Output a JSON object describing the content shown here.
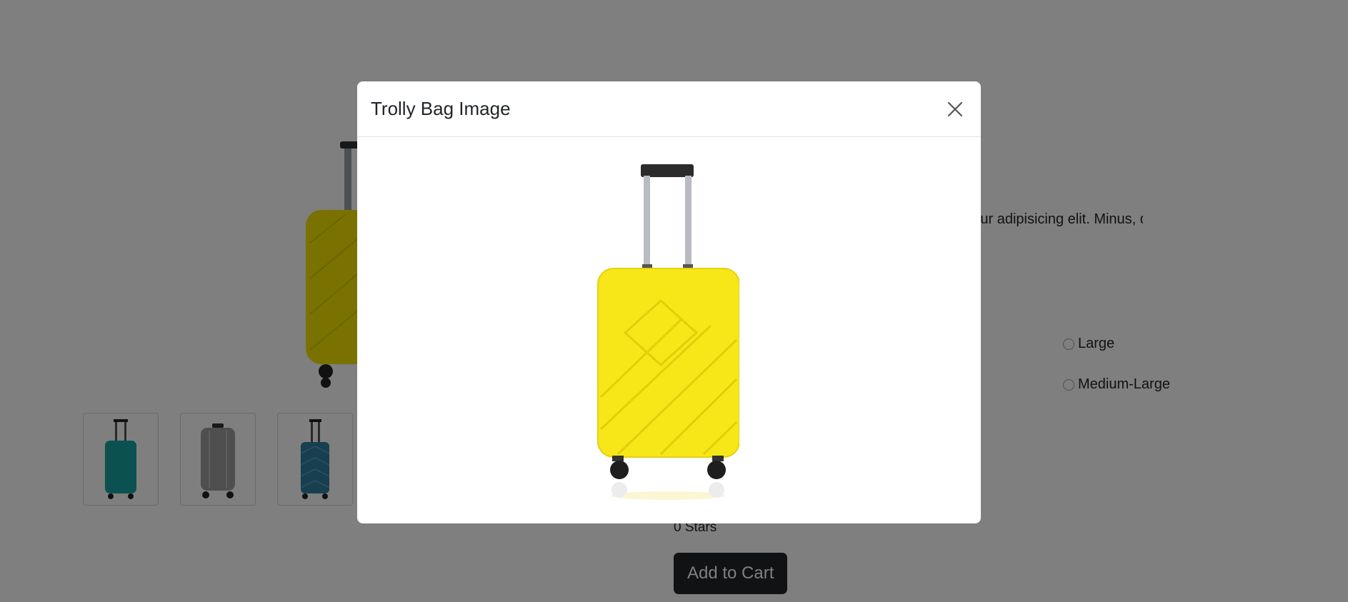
{
  "product": {
    "description": "Lorem ipsum dolor sit amet consectetur adipisicing elit. Minus, dolorem.",
    "main_image": {
      "icon": "yellow-suitcase-image",
      "color": "#f2e500"
    },
    "thumbnails": [
      {
        "icon": "teal-suitcase-image",
        "color": "#16a3a0"
      },
      {
        "icon": "grey-suitcase-image",
        "color": "#9e9e9e"
      },
      {
        "icon": "blue-suitcase-image",
        "color": "#2f7fa0"
      }
    ],
    "sizes": [
      {
        "label": "Large"
      },
      {
        "label": "Medium-Large"
      }
    ],
    "rating_text": "0 Stars",
    "add_to_cart_label": "Add to Cart"
  },
  "modal": {
    "title": "Trolly Bag Image",
    "close_icon": "close-icon",
    "image": {
      "icon": "yellow-suitcase-image",
      "color": "#f7e718"
    }
  }
}
